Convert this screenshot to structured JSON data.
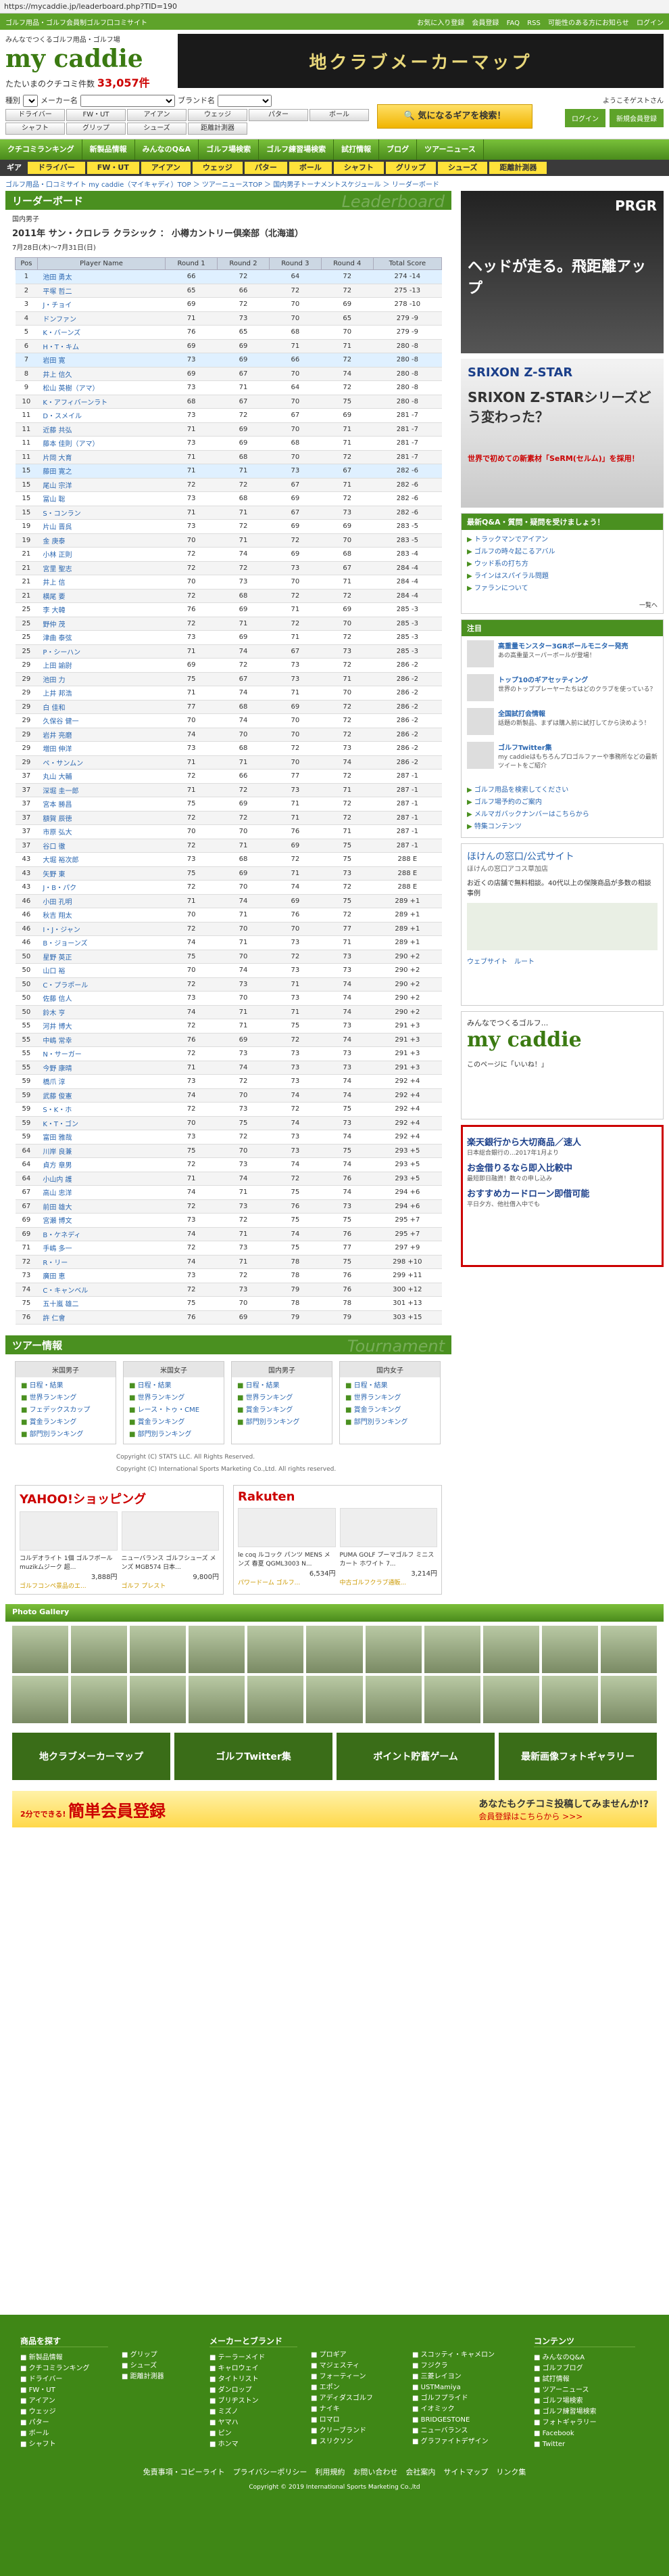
{
  "url": "https://mycaddie.jp/leaderboard.php?TID=190",
  "topbar": {
    "tagline": "ゴルフ用品・ゴルフ会員制ゴルフ口コミサイト",
    "links": [
      "お気に入り登録",
      "会員登録",
      "FAQ",
      "RSS",
      "可能性のある方にお知らせ",
      "ログイン"
    ]
  },
  "header": {
    "tagline": "みんなでつくるゴルフ用品・ゴルフ場",
    "logo": "my caddie",
    "count_label": "たたいまのクチコミ件数",
    "count": "33,057件",
    "banner": "地クラブメーカーマップ"
  },
  "search": {
    "type_label": "種別",
    "maker_label": "メーカー名",
    "brand_label": "ブランド名",
    "cats": [
      "ドライバー",
      "FW・UT",
      "アイアン",
      "ウェッジ",
      "パター",
      "ボール",
      "シャフト",
      "グリップ",
      "シューズ",
      "距離計測器"
    ],
    "bigsearch": "気になるギアを検索！",
    "guest": "ようこそゲストさん",
    "login": "ログイン",
    "register": "新規会員登録"
  },
  "nav1": [
    "クチコミランキング",
    "新製品情報",
    "みんなのQ&A",
    "ゴルフ場検索",
    "ゴルフ練習場検索",
    "試打情報",
    "ブログ",
    "ツアーニュース"
  ],
  "nav2": [
    "ギア",
    "ドライバー",
    "FW・UT",
    "アイアン",
    "ウェッジ",
    "パター",
    "ボール",
    "シャフト",
    "グリップ",
    "シューズ",
    "距離計測器"
  ],
  "breadcrumb": "ゴルフ用品・口コミサイト my caddie（マイキャディ）TOP ＞ ツアーニュースTOP ＞ 国内男子トーナメントスケジュール ＞ リーダーボード",
  "leaderboard": {
    "title": "リーダーボード",
    "title_bg": "Leaderboard",
    "tour": "国内男子",
    "event": "2011年 サン・クロレラ クラシック ： 小樽カントリー倶楽部（北海道）",
    "dates": "7月28日(木)〜7月31日(日)",
    "columns": [
      "Pos",
      "Player Name",
      "Round 1",
      "Round 2",
      "Round 3",
      "Round 4",
      "Total Score"
    ],
    "rows": [
      [
        "1",
        "池田 勇太",
        "66",
        "72",
        "64",
        "72",
        "274",
        "-14"
      ],
      [
        "2",
        "平塚 哲二",
        "65",
        "66",
        "72",
        "72",
        "275",
        "-13"
      ],
      [
        "3",
        "J・チョイ",
        "69",
        "72",
        "70",
        "69",
        "278",
        "-10"
      ],
      [
        "4",
        "ドンファン",
        "71",
        "73",
        "70",
        "65",
        "279",
        "-9"
      ],
      [
        "5",
        "K・バーンズ",
        "76",
        "65",
        "68",
        "70",
        "279",
        "-9"
      ],
      [
        "6",
        "H・T・キム",
        "69",
        "69",
        "71",
        "71",
        "280",
        "-8"
      ],
      [
        "7",
        "岩田 寛",
        "73",
        "69",
        "66",
        "72",
        "280",
        "-8"
      ],
      [
        "8",
        "井上 信久",
        "69",
        "67",
        "70",
        "74",
        "280",
        "-8"
      ],
      [
        "9",
        "松山 英樹（アマ）",
        "73",
        "71",
        "64",
        "72",
        "280",
        "-8"
      ],
      [
        "10",
        "K・アフィバーンラト",
        "68",
        "67",
        "70",
        "75",
        "280",
        "-8"
      ],
      [
        "11",
        "D・スメイル",
        "73",
        "72",
        "67",
        "69",
        "281",
        "-7"
      ],
      [
        "11",
        "近藤 共弘",
        "71",
        "69",
        "70",
        "71",
        "281",
        "-7"
      ],
      [
        "11",
        "藤本 佳則（アマ）",
        "73",
        "69",
        "68",
        "71",
        "281",
        "-7"
      ],
      [
        "11",
        "片岡 大育",
        "71",
        "68",
        "70",
        "72",
        "281",
        "-7"
      ],
      [
        "15",
        "藤田 寛之",
        "71",
        "71",
        "73",
        "67",
        "282",
        "-6"
      ],
      [
        "15",
        "尾山 宗洋",
        "72",
        "72",
        "67",
        "71",
        "282",
        "-6"
      ],
      [
        "15",
        "冨山 聡",
        "73",
        "68",
        "69",
        "72",
        "282",
        "-6"
      ],
      [
        "15",
        "S・コンラン",
        "71",
        "71",
        "67",
        "73",
        "282",
        "-6"
      ],
      [
        "19",
        "片山 晋呉",
        "73",
        "72",
        "69",
        "69",
        "283",
        "-5"
      ],
      [
        "19",
        "金 庚泰",
        "70",
        "71",
        "72",
        "70",
        "283",
        "-5"
      ],
      [
        "21",
        "小林 正則",
        "72",
        "74",
        "69",
        "68",
        "283",
        "-4"
      ],
      [
        "21",
        "宮里 聖志",
        "72",
        "72",
        "73",
        "67",
        "284",
        "-4"
      ],
      [
        "21",
        "井上 信",
        "70",
        "73",
        "70",
        "71",
        "284",
        "-4"
      ],
      [
        "21",
        "横尾 要",
        "72",
        "68",
        "72",
        "72",
        "284",
        "-4"
      ],
      [
        "25",
        "李 大韓",
        "76",
        "69",
        "71",
        "69",
        "285",
        "-3"
      ],
      [
        "25",
        "野仲 茂",
        "72",
        "71",
        "72",
        "70",
        "285",
        "-3"
      ],
      [
        "25",
        "津曲 泰弦",
        "73",
        "69",
        "71",
        "72",
        "285",
        "-3"
      ],
      [
        "25",
        "P・シーハン",
        "71",
        "74",
        "67",
        "73",
        "285",
        "-3"
      ],
      [
        "29",
        "上田 諭尉",
        "69",
        "72",
        "73",
        "72",
        "286",
        "-2"
      ],
      [
        "29",
        "池田 力",
        "75",
        "67",
        "73",
        "71",
        "286",
        "-2"
      ],
      [
        "29",
        "上井 邦浩",
        "71",
        "74",
        "71",
        "70",
        "286",
        "-2"
      ],
      [
        "29",
        "白 佳和",
        "77",
        "68",
        "69",
        "72",
        "286",
        "-2"
      ],
      [
        "29",
        "久保谷 健一",
        "70",
        "74",
        "70",
        "72",
        "286",
        "-2"
      ],
      [
        "29",
        "岩井 亮磨",
        "74",
        "70",
        "70",
        "72",
        "286",
        "-2"
      ],
      [
        "29",
        "増田 伸洋",
        "73",
        "68",
        "72",
        "73",
        "286",
        "-2"
      ],
      [
        "29",
        "ペ・サンムン",
        "71",
        "71",
        "70",
        "74",
        "286",
        "-2"
      ],
      [
        "37",
        "丸山 大輔",
        "72",
        "66",
        "77",
        "72",
        "287",
        "-1"
      ],
      [
        "37",
        "深堀 圭一郎",
        "71",
        "72",
        "73",
        "71",
        "287",
        "-1"
      ],
      [
        "37",
        "宮本 勝昌",
        "75",
        "69",
        "71",
        "72",
        "287",
        "-1"
      ],
      [
        "37",
        "額賀 辰徳",
        "72",
        "72",
        "71",
        "72",
        "287",
        "-1"
      ],
      [
        "37",
        "市原 弘大",
        "70",
        "70",
        "76",
        "71",
        "287",
        "-1"
      ],
      [
        "37",
        "谷口 徹",
        "72",
        "71",
        "69",
        "75",
        "287",
        "-1"
      ],
      [
        "43",
        "大堀 裕次郎",
        "73",
        "68",
        "72",
        "75",
        "288",
        "E"
      ],
      [
        "43",
        "矢野 東",
        "75",
        "69",
        "71",
        "73",
        "288",
        "E"
      ],
      [
        "43",
        "J・B・パク",
        "72",
        "70",
        "74",
        "72",
        "288",
        "E"
      ],
      [
        "46",
        "小田 孔明",
        "71",
        "74",
        "69",
        "75",
        "289",
        "+1"
      ],
      [
        "46",
        "秋吉 翔太",
        "70",
        "71",
        "76",
        "72",
        "289",
        "+1"
      ],
      [
        "46",
        "I・J・ジャン",
        "72",
        "70",
        "70",
        "77",
        "289",
        "+1"
      ],
      [
        "46",
        "B・ジョーンズ",
        "74",
        "71",
        "73",
        "71",
        "289",
        "+1"
      ],
      [
        "50",
        "星野 英正",
        "75",
        "70",
        "72",
        "73",
        "290",
        "+2"
      ],
      [
        "50",
        "山口 裕",
        "70",
        "74",
        "73",
        "73",
        "290",
        "+2"
      ],
      [
        "50",
        "C・プラポール",
        "72",
        "73",
        "71",
        "74",
        "290",
        "+2"
      ],
      [
        "50",
        "佐藤 信人",
        "73",
        "70",
        "73",
        "74",
        "290",
        "+2"
      ],
      [
        "50",
        "鈴木 亨",
        "74",
        "71",
        "71",
        "74",
        "290",
        "+2"
      ],
      [
        "55",
        "河井 博大",
        "72",
        "71",
        "75",
        "73",
        "291",
        "+3"
      ],
      [
        "55",
        "中嶋 常幸",
        "76",
        "69",
        "72",
        "74",
        "291",
        "+3"
      ],
      [
        "55",
        "N・サーガー",
        "72",
        "73",
        "73",
        "73",
        "291",
        "+3"
      ],
      [
        "55",
        "今野 康晴",
        "71",
        "74",
        "73",
        "73",
        "291",
        "+3"
      ],
      [
        "59",
        "橋爪 淳",
        "73",
        "72",
        "73",
        "74",
        "292",
        "+4"
      ],
      [
        "59",
        "武藤 俊憲",
        "74",
        "70",
        "74",
        "74",
        "292",
        "+4"
      ],
      [
        "59",
        "S・K・ホ",
        "72",
        "73",
        "72",
        "75",
        "292",
        "+4"
      ],
      [
        "59",
        "K・T・ゴン",
        "70",
        "75",
        "74",
        "73",
        "292",
        "+4"
      ],
      [
        "59",
        "富田 雅哉",
        "73",
        "72",
        "73",
        "74",
        "292",
        "+4"
      ],
      [
        "64",
        "川岸 良兼",
        "75",
        "70",
        "73",
        "75",
        "293",
        "+5"
      ],
      [
        "64",
        "貞方 章男",
        "72",
        "73",
        "74",
        "74",
        "293",
        "+5"
      ],
      [
        "64",
        "小山内 護",
        "71",
        "74",
        "72",
        "76",
        "293",
        "+5"
      ],
      [
        "67",
        "高山 忠洋",
        "74",
        "71",
        "75",
        "74",
        "294",
        "+6"
      ],
      [
        "67",
        "前田 雄大",
        "72",
        "73",
        "76",
        "73",
        "294",
        "+6"
      ],
      [
        "69",
        "宮瀬 博文",
        "73",
        "72",
        "75",
        "75",
        "295",
        "+7"
      ],
      [
        "69",
        "B・ケネディ",
        "74",
        "71",
        "74",
        "76",
        "295",
        "+7"
      ],
      [
        "71",
        "手嶋 多一",
        "72",
        "73",
        "75",
        "77",
        "297",
        "+9"
      ],
      [
        "72",
        "R・リー",
        "74",
        "71",
        "78",
        "75",
        "298",
        "+10"
      ],
      [
        "73",
        "廣田 恵",
        "73",
        "72",
        "78",
        "76",
        "299",
        "+11"
      ],
      [
        "74",
        "C・キャンベル",
        "72",
        "73",
        "79",
        "76",
        "300",
        "+12"
      ],
      [
        "75",
        "五十嵐 雄二",
        "75",
        "70",
        "78",
        "78",
        "301",
        "+13"
      ],
      [
        "76",
        "許 仁會",
        "76",
        "69",
        "79",
        "79",
        "303",
        "+15"
      ]
    ]
  },
  "tour_info": {
    "title": "ツアー情報",
    "title_bg": "Tournament",
    "cols": [
      {
        "name": "米国男子",
        "items": [
          "日程・結果",
          "世界ランキング",
          "フェデックスカップ",
          "賞金ランキング",
          "部門別ランキング"
        ]
      },
      {
        "name": "米国女子",
        "items": [
          "日程・結果",
          "世界ランキング",
          "レース・トゥ・CME",
          "賞金ランキング",
          "部門別ランキング"
        ]
      },
      {
        "name": "国内男子",
        "items": [
          "日程・結果",
          "世界ランキング",
          "賞金ランキング",
          "部門別ランキング"
        ]
      },
      {
        "name": "国内女子",
        "items": [
          "日程・結果",
          "世界ランキング",
          "賞金ランキング",
          "部門別ランキング"
        ]
      }
    ],
    "copyright1": "Copyright (C) STATS LLC. All Rights Reserved.",
    "copyright2": "Copyright (C) International Sports Marketing Co.,Ltd. All rights reserved."
  },
  "shops": [
    {
      "brand": "YAHOO!ショッピング",
      "items": [
        {
          "name": "コルデオライト 1個 ゴルフボール muzikムジーク 超...",
          "price": "3,888円",
          "store": "ゴルフコンペ景品のエ..."
        },
        {
          "name": "ニューバランス ゴルフシューズ メンズ MGB574 日本...",
          "price": "9,800円",
          "store": "ゴルフ プレスト"
        }
      ]
    },
    {
      "brand": "Rakuten",
      "items": [
        {
          "name": "le coq ルコック パンツ MENS メンズ 春夏 QGML3003 N...",
          "price": "6,534円",
          "store": "パワードーム ゴルフ..."
        },
        {
          "name": "PUMA GOLF プーマゴルフ ミニスカート ホワイト 7...",
          "price": "3,214円",
          "store": "中古ゴルフクラブ通販..."
        }
      ]
    }
  ],
  "photo_gallery": "Photo Gallery",
  "promos": [
    "地クラブメーカーマップ",
    "ゴルフTwitter集",
    "ポイント貯蓄ゲーム",
    "最新画像フォトギャラリー"
  ],
  "register": {
    "small": "2分でできる!",
    "big": "簡単会員登録",
    "sub": "あなたもクチコミ投稿してみませんか!?",
    "sub2": "会員登録はこちらから >>>"
  },
  "right": {
    "ad1": {
      "brand": "PRGR",
      "text": "ヘッドが走る。飛距離アップ"
    },
    "ad2": {
      "brand": "SRIXON Z-STAR",
      "text": "SRIXON Z-STARシリーズどう変わった？",
      "sub": "世界で初めての新素材「SeRM(セルム)」を採用！"
    },
    "qa_head": "最新Q&A・質問・疑問を受けましょう！",
    "qa_items": [
      "トラックマンでアイアン",
      "ゴルフの時々起こるアバル",
      "ウッド系の打ち方",
      "ラインはスパイラル問題",
      "ファランについて"
    ],
    "qa_more": "一覧へ",
    "news_head": "注目",
    "news": [
      {
        "title": "高重量モンスター3GRボールモニター発売",
        "text": "あの高重量スーパーボールが登場！"
      },
      {
        "title": "トップ10のギアセッティング",
        "text": "世界のトッププレーヤーたちはどのクラブを使っている？"
      },
      {
        "title": "全国試打会情報",
        "text": "話題の新製品、まずは購入前に試打してから決めよう！"
      },
      {
        "title": "ゴルフTwitter集",
        "text": "my caddieはもちろんプロゴルファーや事務所などの最新ツイートをご紹介"
      }
    ],
    "links": [
      "ゴルフ用品を検索してください",
      "ゴルフ場予約のご案内",
      "メルマガバックナンバーはこちらから",
      "特集コンテンツ"
    ],
    "map": {
      "title": "ほけんの窓口/公式サイト",
      "url": "ほけんの窓口アコス草加店",
      "text": "お近くの店舗で無料相談。40代以上の保険商品が多数の相談事例",
      "web": "ウェブサイト",
      "route": "ルート"
    },
    "mc": {
      "tag": "みんなでつくるゴルフ...",
      "logo": "my caddie",
      "like": "このページに「いいね！」"
    },
    "txtad": [
      {
        "title": "楽天銀行から大切商品／速人",
        "text": "日本総合銀行の...2017年1月より"
      },
      {
        "title": "お金借りるなら即入比較中",
        "text": "最短即日融資！数々の申し込み"
      },
      {
        "title": "おすすめカードローン即借可能",
        "text": "平日夕方、他社借入中でも"
      }
    ]
  },
  "footer": {
    "col1_title": "商品を探す",
    "col1": [
      "新製品情報",
      "クチコミランキング",
      "ドライバー",
      "FW・UT",
      "アイアン",
      "ウェッジ",
      "パター",
      "ボール",
      "シャフト"
    ],
    "col2": [
      "グリップ",
      "シューズ",
      "距離計測器"
    ],
    "col3_title": "メーカーとブランド",
    "col3": [
      "テーラーメイド",
      "キャロウェイ",
      "タイトリスト",
      "ダンロップ",
      "ブリヂストン",
      "ミズノ",
      "ヤマハ",
      "ピン",
      "ホンマ"
    ],
    "col4": [
      "プロギア",
      "マジェスティ",
      "フォーティーン",
      "エポン",
      "アディダスゴルフ",
      "ナイキ",
      "ロマロ",
      "クリーブランド",
      "スリクソン"
    ],
    "col5": [
      "スコッティ・キャメロン",
      "フジクラ",
      "三菱レイヨン",
      "USTMamiya",
      "ゴルフプライド",
      "イオミック",
      "BRIDGESTONE",
      "ニューバランス",
      "グラファイトデザイン"
    ],
    "col6_title": "コンテンツ",
    "col6": [
      "みんなのQ&A",
      "ゴルフブログ",
      "試打情報",
      "ツアーニュース",
      "ゴルフ場検索",
      "ゴルフ練習場検索",
      "フォトギャラリー",
      "Facebook",
      "Twitter"
    ],
    "links": [
      "免責事項・コピーライト",
      "プライバシーポリシー",
      "利用規約",
      "お問い合わせ",
      "会社案内",
      "サイトマップ",
      "リンク集"
    ],
    "copyright": "Copyright © 2019 International Sports Marketing Co.,ltd"
  }
}
